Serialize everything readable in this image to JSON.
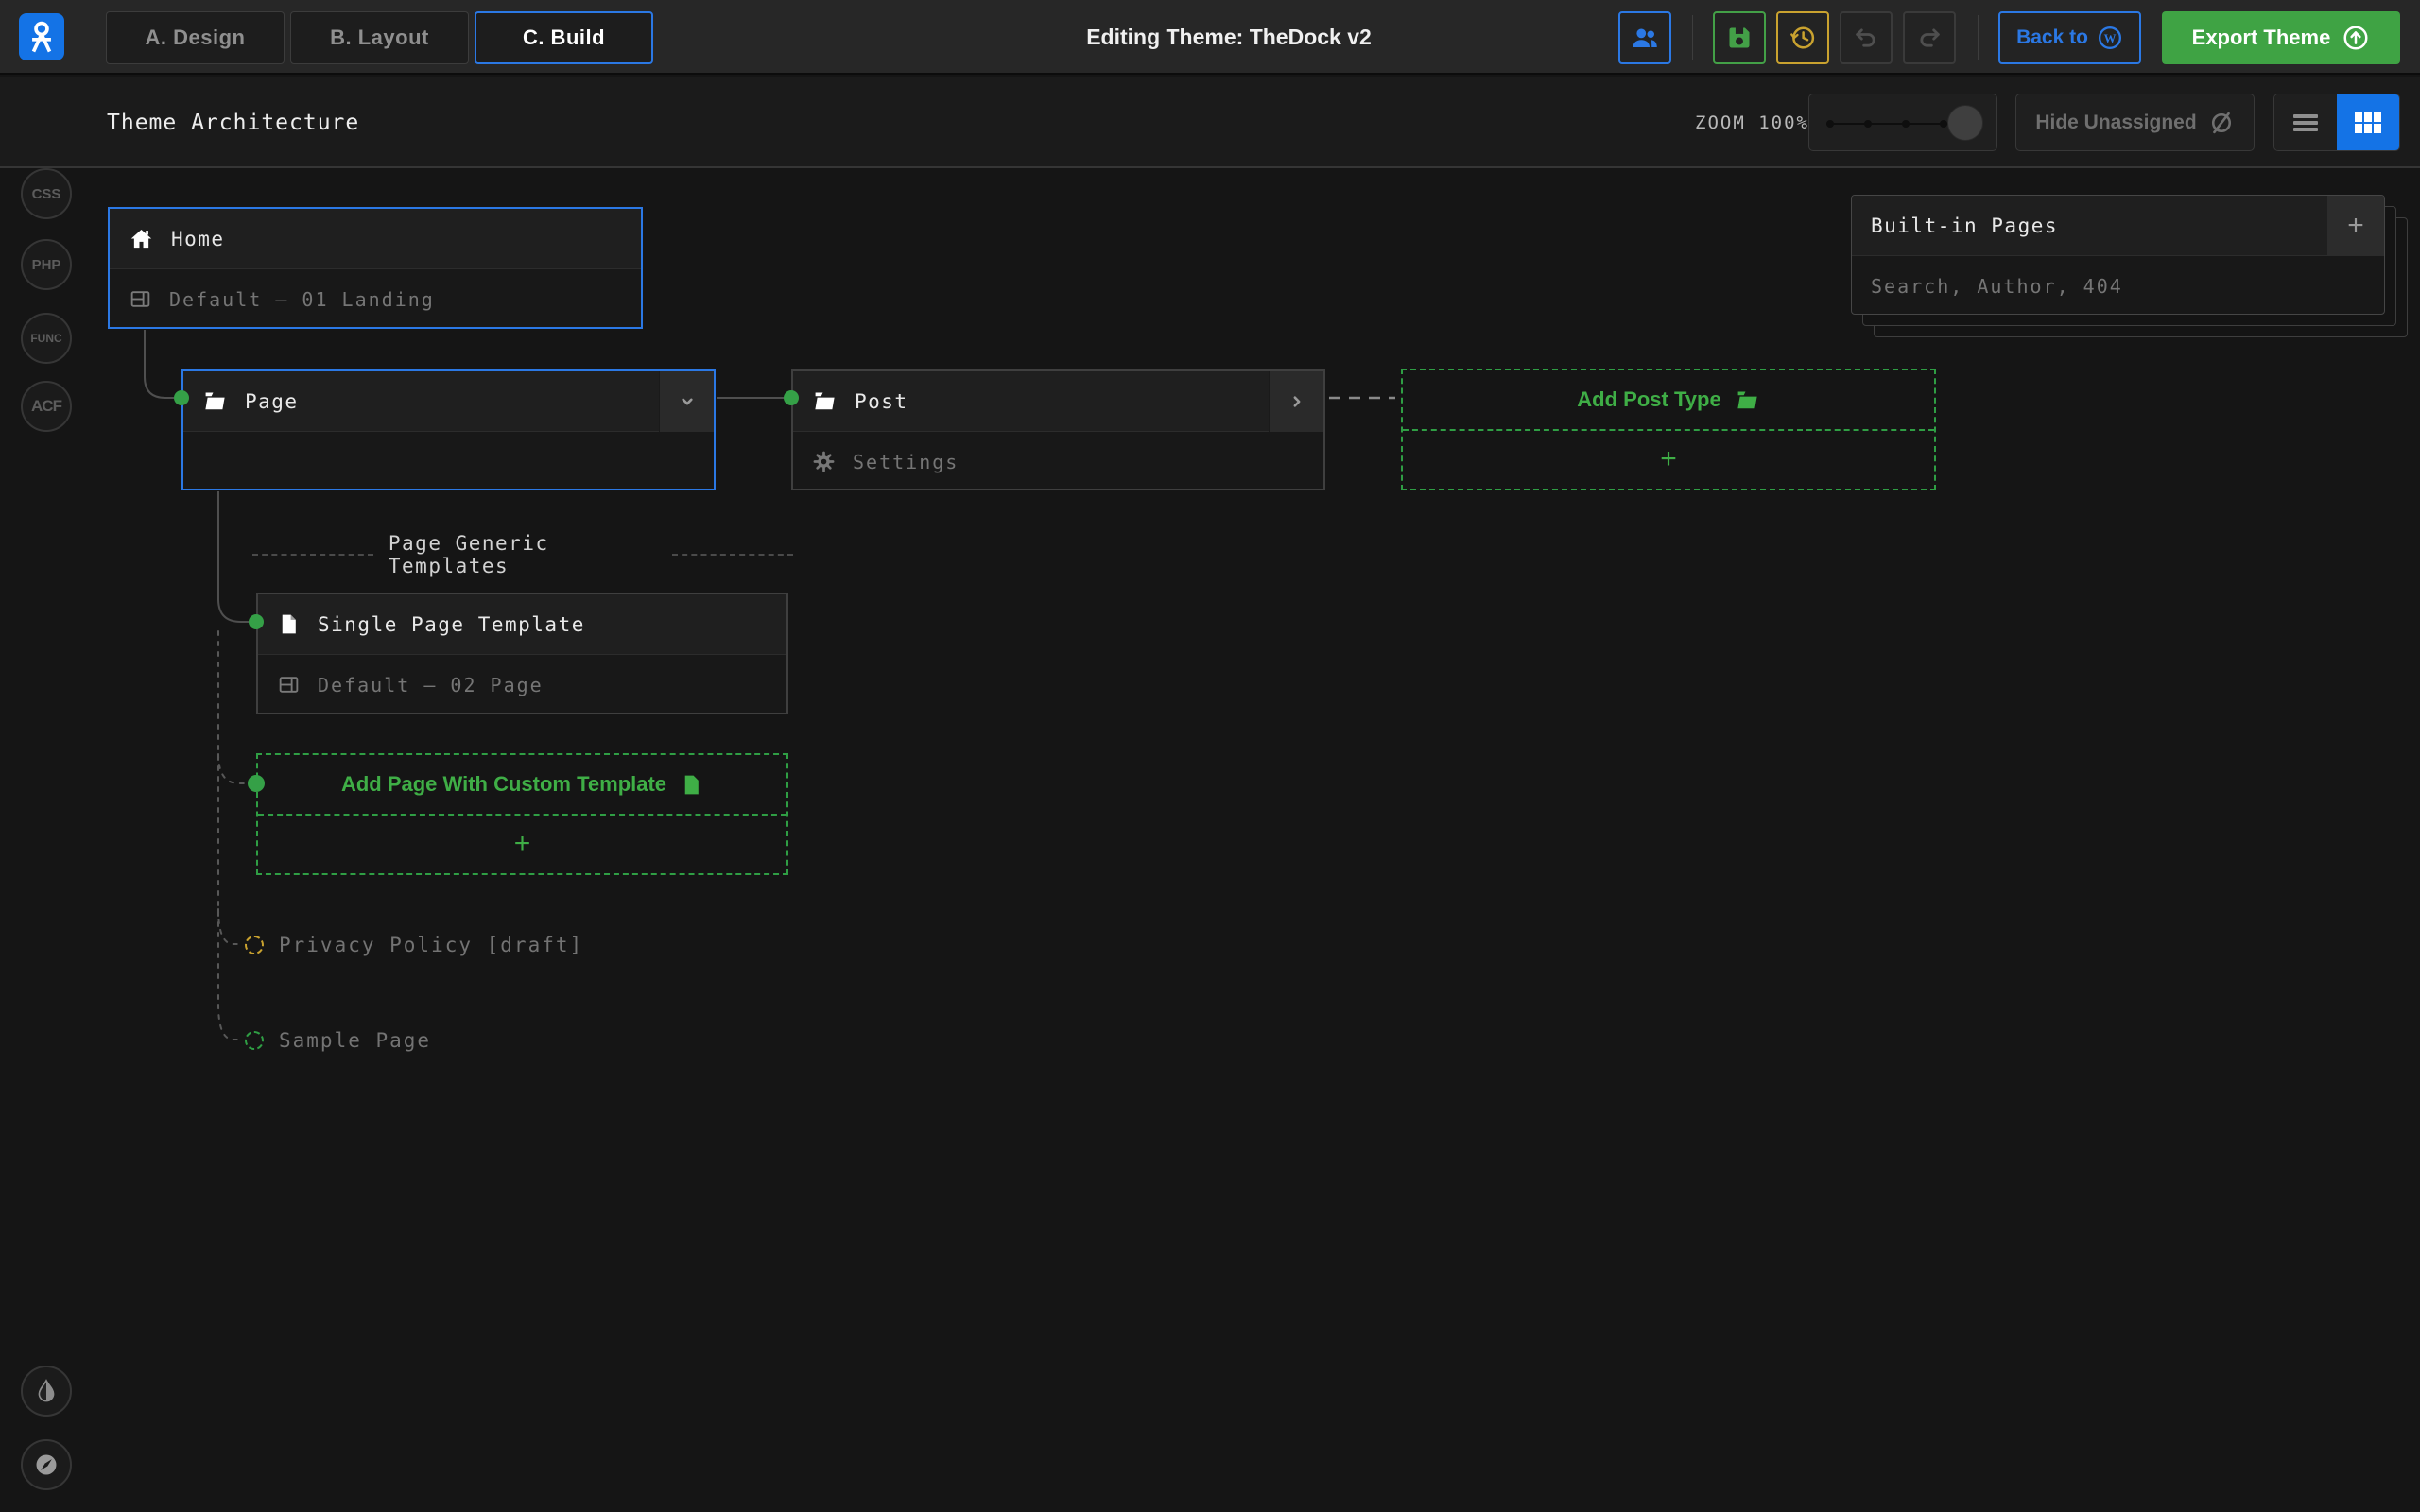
{
  "colors": {
    "accent_blue": "#2b78e4",
    "green": "#3fae46",
    "yellow": "#c9a22f"
  },
  "topbar": {
    "title": "Editing Theme: TheDock v2",
    "tabs": [
      {
        "label": "A. Design"
      },
      {
        "label": "B. Layout"
      },
      {
        "label": "C. Build"
      }
    ],
    "back_label": "Back to",
    "export_label": "Export Theme"
  },
  "toolbar": {
    "title": "Theme Architecture",
    "zoom_label": "ZOOM 100%",
    "hide_unassigned_label": "Hide Unassigned"
  },
  "rail": {
    "items": [
      {
        "label": "CSS"
      },
      {
        "label": "PHP"
      },
      {
        "label": "FUNC"
      },
      {
        "label": "ACF"
      }
    ]
  },
  "canvas": {
    "home": {
      "title": "Home",
      "template": "Default – 01 Landing"
    },
    "page": {
      "title": "Page"
    },
    "post": {
      "title": "Post",
      "settings_label": "Settings"
    },
    "add_post_type": {
      "label": "Add Post Type",
      "plus": "+"
    },
    "builtin_pages": {
      "title": "Built-in Pages",
      "items": "Search, Author, 404",
      "plus": "+"
    },
    "generic_templates_label": "Page Generic Templates",
    "single_page_template": {
      "title": "Single Page Template",
      "template": "Default – 02 Page"
    },
    "add_page": {
      "label": "Add Page With Custom Template",
      "plus": "+"
    },
    "orphans": [
      {
        "label": "Privacy Policy [draft]"
      },
      {
        "label": "Sample Page"
      }
    ]
  }
}
